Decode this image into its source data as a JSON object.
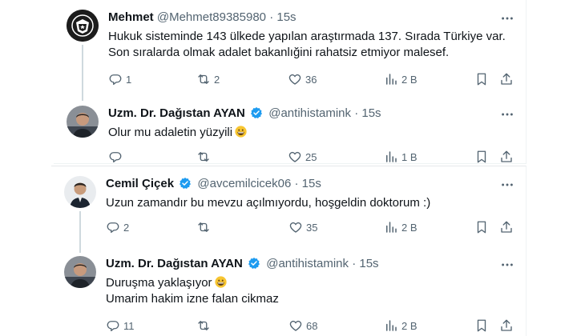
{
  "tweets": [
    {
      "name": "Mehmet",
      "handle": "@Mehmet89385980",
      "separator": "·",
      "time": "15s",
      "verified": false,
      "avatar": "besiktas-logo",
      "lines": [
        "Hukuk sisteminde 143 ülkede yapılan araştırmada 137. Sırada Türkiye var.",
        "Son sıralarda olmak adalet bakanlığini rahatsiz etmiyor malesef."
      ],
      "replies": "1",
      "retweets": "2",
      "likes": "36",
      "views": "2 B"
    },
    {
      "name": "Uzm. Dr. Dağıstan AYAN",
      "handle": "@antihistamink",
      "separator": "·",
      "time": "15s",
      "verified": true,
      "avatar": "user-photo",
      "lines": [
        "Olur mu adaletin yüzyili"
      ],
      "emoji": "grinning-face",
      "replies": "",
      "retweets": "",
      "likes": "25",
      "views": "1 B"
    },
    {
      "name": "Cemil Çiçek",
      "handle": "@avcemilcicek06",
      "separator": "·",
      "time": "15s",
      "verified": true,
      "avatar": "user-photo",
      "lines": [
        "Uzun zamandır bu mevzu açılmıyordu, hoşgeldin doktorum :)"
      ],
      "replies": "2",
      "retweets": "",
      "likes": "35",
      "views": "2 B"
    },
    {
      "name": "Uzm. Dr. Dağıstan AYAN",
      "handle": "@antihistamink",
      "separator": "·",
      "time": "15s",
      "verified": true,
      "avatar": "user-photo",
      "lines": [
        "Duruşma yaklaşıyor",
        "Umarim hakim izne falan cikmaz"
      ],
      "emoji": "grinning-face",
      "replies": "11",
      "retweets": "",
      "likes": "68",
      "views": "2 B"
    }
  ],
  "icons": {
    "reply": "reply-icon",
    "retweet": "retweet-icon",
    "like": "heart-icon",
    "views": "views-icon",
    "bookmark": "bookmark-icon",
    "share": "share-icon",
    "more": "more-icon",
    "verified": "verified-badge-icon"
  },
  "colors": {
    "text": "#0f1419",
    "secondary": "#536471",
    "verified": "#1d9bf0",
    "border": "#eff3f4"
  }
}
